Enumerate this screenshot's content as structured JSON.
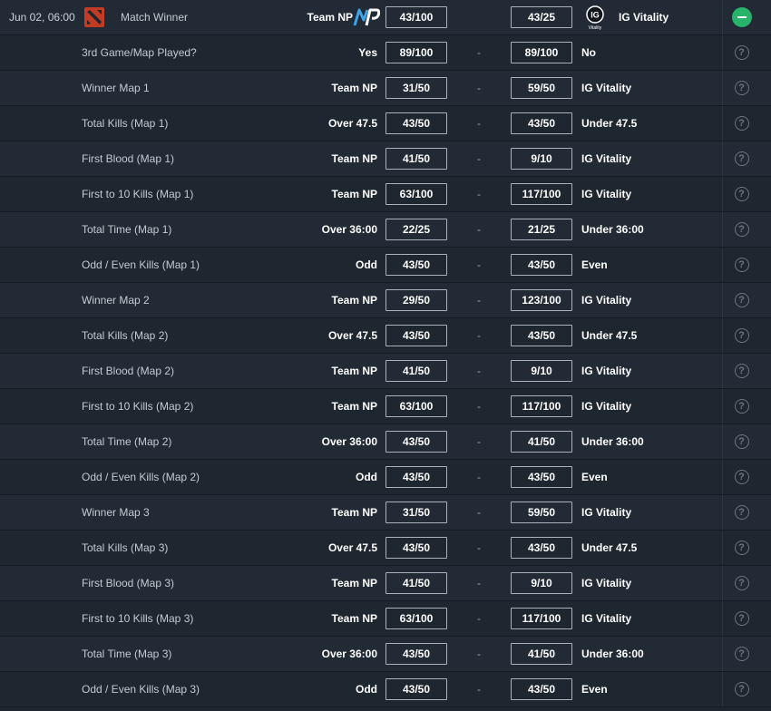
{
  "header": {
    "date": "Jun 02, 06:00",
    "game_icon": "dota2-icon",
    "market": "Match Winner",
    "home_team": "Team NP",
    "home_odds": "43/100",
    "away_odds": "43/25",
    "away_team": "IG Vitality",
    "away_logo_text": "Vitality"
  },
  "rows": [
    {
      "market": "3rd Game/Map Played?",
      "home": "Yes",
      "home_odds": "89/100",
      "sep": "-",
      "away_odds": "89/100",
      "away": "No"
    },
    {
      "market": "Winner Map 1",
      "home": "Team NP",
      "home_odds": "31/50",
      "sep": "-",
      "away_odds": "59/50",
      "away": "IG Vitality"
    },
    {
      "market": "Total Kills (Map 1)",
      "home": "Over 47.5",
      "home_odds": "43/50",
      "sep": "-",
      "away_odds": "43/50",
      "away": "Under 47.5"
    },
    {
      "market": "First Blood (Map 1)",
      "home": "Team NP",
      "home_odds": "41/50",
      "sep": "-",
      "away_odds": "9/10",
      "away": "IG Vitality"
    },
    {
      "market": "First to 10 Kills (Map 1)",
      "home": "Team NP",
      "home_odds": "63/100",
      "sep": "-",
      "away_odds": "117/100",
      "away": "IG Vitality"
    },
    {
      "market": "Total Time (Map 1)",
      "home": "Over 36:00",
      "home_odds": "22/25",
      "sep": "-",
      "away_odds": "21/25",
      "away": "Under 36:00"
    },
    {
      "market": "Odd / Even Kills (Map 1)",
      "home": "Odd",
      "home_odds": "43/50",
      "sep": "-",
      "away_odds": "43/50",
      "away": "Even"
    },
    {
      "market": "Winner Map 2",
      "home": "Team NP",
      "home_odds": "29/50",
      "sep": "-",
      "away_odds": "123/100",
      "away": "IG Vitality"
    },
    {
      "market": "Total Kills (Map 2)",
      "home": "Over 47.5",
      "home_odds": "43/50",
      "sep": "-",
      "away_odds": "43/50",
      "away": "Under 47.5"
    },
    {
      "market": "First Blood (Map 2)",
      "home": "Team NP",
      "home_odds": "41/50",
      "sep": "-",
      "away_odds": "9/10",
      "away": "IG Vitality"
    },
    {
      "market": "First to 10 Kills (Map 2)",
      "home": "Team NP",
      "home_odds": "63/100",
      "sep": "-",
      "away_odds": "117/100",
      "away": "IG Vitality"
    },
    {
      "market": "Total Time (Map 2)",
      "home": "Over 36:00",
      "home_odds": "43/50",
      "sep": "-",
      "away_odds": "41/50",
      "away": "Under 36:00"
    },
    {
      "market": "Odd / Even Kills (Map 2)",
      "home": "Odd",
      "home_odds": "43/50",
      "sep": "-",
      "away_odds": "43/50",
      "away": "Even"
    },
    {
      "market": "Winner Map 3",
      "home": "Team NP",
      "home_odds": "31/50",
      "sep": "-",
      "away_odds": "59/50",
      "away": "IG Vitality"
    },
    {
      "market": "Total Kills (Map 3)",
      "home": "Over 47.5",
      "home_odds": "43/50",
      "sep": "-",
      "away_odds": "43/50",
      "away": "Under 47.5"
    },
    {
      "market": "First Blood (Map 3)",
      "home": "Team NP",
      "home_odds": "41/50",
      "sep": "-",
      "away_odds": "9/10",
      "away": "IG Vitality"
    },
    {
      "market": "First to 10 Kills (Map 3)",
      "home": "Team NP",
      "home_odds": "63/100",
      "sep": "-",
      "away_odds": "117/100",
      "away": "IG Vitality"
    },
    {
      "market": "Total Time (Map 3)",
      "home": "Over 36:00",
      "home_odds": "43/50",
      "sep": "-",
      "away_odds": "41/50",
      "away": "Under 36:00"
    },
    {
      "market": "Odd / Even Kills (Map 3)",
      "home": "Odd",
      "home_odds": "43/50",
      "sep": "-",
      "away_odds": "43/50",
      "away": "Even"
    }
  ],
  "help_symbol": "?",
  "colors": {
    "accent_green": "#27b36a",
    "dota_red": "#c23b22",
    "np_blue": "#3fa3e8"
  }
}
